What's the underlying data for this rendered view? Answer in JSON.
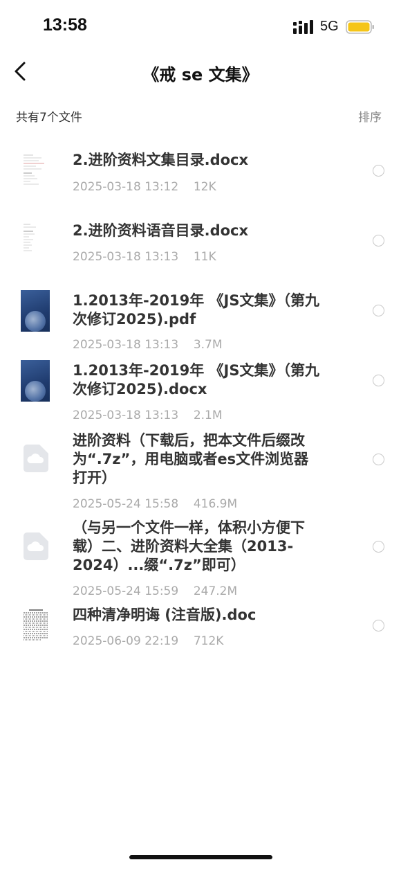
{
  "status": {
    "time": "13:58",
    "network": "5G",
    "battery_color": "#F5C518"
  },
  "nav": {
    "title": "《戒 se 文集》",
    "back_icon": "chevron-left-icon"
  },
  "toolbar": {
    "file_count": "共有7个文件",
    "sort_label": "排序"
  },
  "files": [
    {
      "name": "2.进阶资料文集目录.docx",
      "date": "2025-03-18 13:12",
      "size": "12K",
      "thumb": "doc-preview-icon"
    },
    {
      "name": "2.进阶资料语音目录.docx",
      "date": "2025-03-18 13:13",
      "size": "11K",
      "thumb": "doc-preview-icon"
    },
    {
      "name": "1.2013年-2019年 《JS文集》（第九次修订2025).pdf",
      "date": "2025-03-18 13:13",
      "size": "3.7M",
      "thumb": "book-cover-icon"
    },
    {
      "name": "1.2013年-2019年 《JS文集》（第九次修订2025).docx",
      "date": "2025-03-18 13:13",
      "size": "2.1M",
      "thumb": "book-cover-icon"
    },
    {
      "name": "进阶资料（下载后，把本文件后缀改为“.7z”，用电脑或者es文件浏览器打开）",
      "date": "2025-05-24 15:58",
      "size": "416.9M",
      "thumb": "cloud-file-icon"
    },
    {
      "name": "（与另一个文件一样，体积小方便下载）二、进阶资料大全集（2013-2024）...缀“.7z”即可）",
      "date": "2025-05-24 15:59",
      "size": "247.2M",
      "thumb": "cloud-file-icon"
    },
    {
      "name": "四种清净明诲 (注音版).doc",
      "date": "2025-06-09 22:19",
      "size": "712K",
      "thumb": "text-page-icon"
    }
  ]
}
